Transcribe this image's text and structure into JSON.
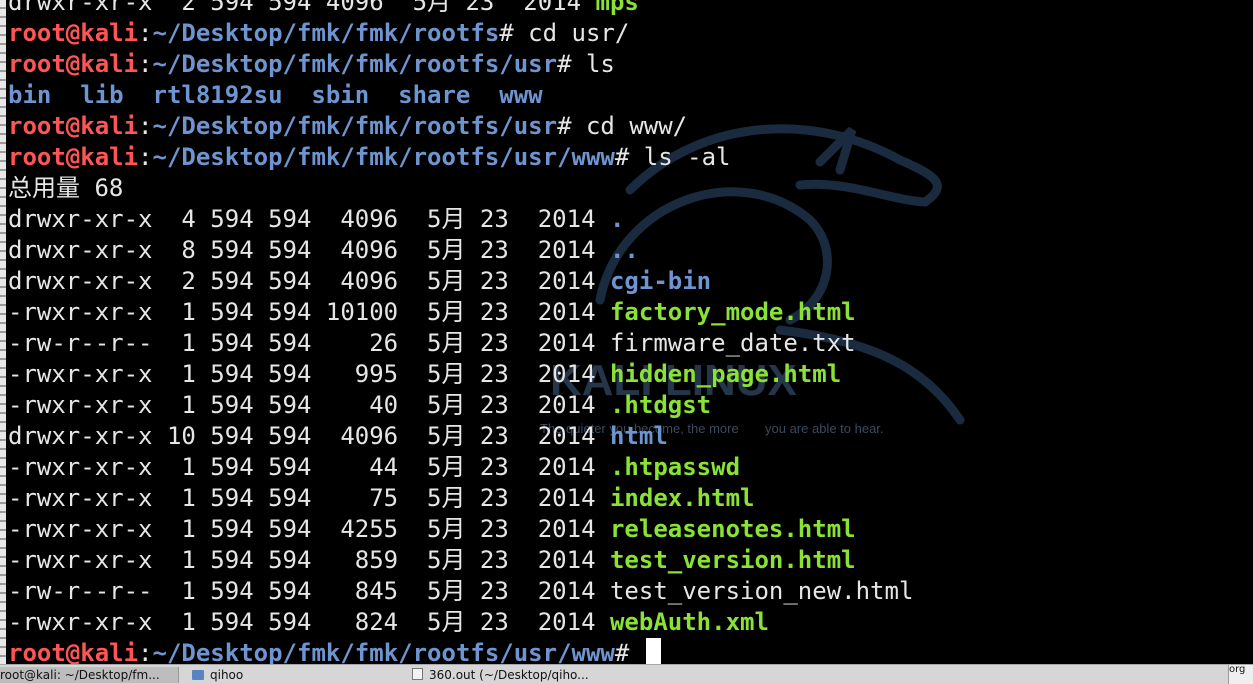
{
  "prompt": {
    "user": "root",
    "at": "@",
    "host": "kali",
    "sep": ":"
  },
  "watermark": {
    "title": "KALI LINUX",
    "quote_left": "The quieter you become, the more",
    "quote_right": "you are able to hear."
  },
  "lines": [
    [
      {
        "c": "plain",
        "t": "drwxr-xr-x  2 594 594 4096  5月 23  2014 "
      },
      {
        "c": "exe",
        "t": "mps"
      }
    ],
    [
      {
        "c": "red",
        "t": "root@kali"
      },
      {
        "c": "plain",
        "t": ":"
      },
      {
        "c": "path",
        "t": "~/Desktop/fmk/fmk/rootfs"
      },
      {
        "c": "plain",
        "t": "# cd usr/"
      }
    ],
    [
      {
        "c": "red",
        "t": "root@kali"
      },
      {
        "c": "plain",
        "t": ":"
      },
      {
        "c": "path",
        "t": "~/Desktop/fmk/fmk/rootfs/usr"
      },
      {
        "c": "plain",
        "t": "# ls"
      }
    ],
    [
      {
        "c": "dir",
        "t": "bin  lib  rtl8192su  sbin  share  www"
      }
    ],
    [
      {
        "c": "red",
        "t": "root@kali"
      },
      {
        "c": "plain",
        "t": ":"
      },
      {
        "c": "path",
        "t": "~/Desktop/fmk/fmk/rootfs/usr"
      },
      {
        "c": "plain",
        "t": "# cd www/"
      }
    ],
    [
      {
        "c": "red",
        "t": "root@kali"
      },
      {
        "c": "plain",
        "t": ":"
      },
      {
        "c": "path",
        "t": "~/Desktop/fmk/fmk/rootfs/usr/www"
      },
      {
        "c": "plain",
        "t": "# ls -al"
      }
    ],
    [
      {
        "c": "plain",
        "t": "总用量 68"
      }
    ],
    [
      {
        "c": "plain",
        "t": "drwxr-xr-x  4 594 594  4096  5月 23  2014 "
      },
      {
        "c": "dir",
        "t": "."
      }
    ],
    [
      {
        "c": "plain",
        "t": "drwxr-xr-x  8 594 594  4096  5月 23  2014 "
      },
      {
        "c": "dir",
        "t": ".."
      }
    ],
    [
      {
        "c": "plain",
        "t": "drwxr-xr-x  2 594 594  4096  5月 23  2014 "
      },
      {
        "c": "dir",
        "t": "cgi-bin"
      }
    ],
    [
      {
        "c": "plain",
        "t": "-rwxr-xr-x  1 594 594 10100  5月 23  2014 "
      },
      {
        "c": "exe",
        "t": "factory_mode.html"
      }
    ],
    [
      {
        "c": "plain",
        "t": "-rw-r--r--  1 594 594    26  5月 23  2014 "
      },
      {
        "c": "plain",
        "t": "firmware_date.txt"
      }
    ],
    [
      {
        "c": "plain",
        "t": "-rwxr-xr-x  1 594 594   995  5月 23  2014 "
      },
      {
        "c": "exe",
        "t": "hidden_page.html"
      }
    ],
    [
      {
        "c": "plain",
        "t": "-rwxr-xr-x  1 594 594    40  5月 23  2014 "
      },
      {
        "c": "exe",
        "t": ".htdgst"
      }
    ],
    [
      {
        "c": "plain",
        "t": "drwxr-xr-x 10 594 594  4096  5月 23  2014 "
      },
      {
        "c": "dir",
        "t": "html"
      }
    ],
    [
      {
        "c": "plain",
        "t": "-rwxr-xr-x  1 594 594    44  5月 23  2014 "
      },
      {
        "c": "exe",
        "t": ".htpasswd"
      }
    ],
    [
      {
        "c": "plain",
        "t": "-rwxr-xr-x  1 594 594    75  5月 23  2014 "
      },
      {
        "c": "exe",
        "t": "index.html"
      }
    ],
    [
      {
        "c": "plain",
        "t": "-rwxr-xr-x  1 594 594  4255  5月 23  2014 "
      },
      {
        "c": "exe",
        "t": "releasenotes.html"
      }
    ],
    [
      {
        "c": "plain",
        "t": "-rwxr-xr-x  1 594 594   859  5月 23  2014 "
      },
      {
        "c": "exe",
        "t": "test_version.html"
      }
    ],
    [
      {
        "c": "plain",
        "t": "-rw-r--r--  1 594 594   845  5月 23  2014 "
      },
      {
        "c": "plain",
        "t": "test_version_new.html"
      }
    ],
    [
      {
        "c": "plain",
        "t": "-rwxr-xr-x  1 594 594   824  5月 23  2014 "
      },
      {
        "c": "exe",
        "t": "webAuth.xml"
      }
    ],
    [
      {
        "c": "red",
        "t": "root@kali"
      },
      {
        "c": "plain",
        "t": ":"
      },
      {
        "c": "path",
        "t": "~/Desktop/fmk/fmk/rootfs/usr/www"
      },
      {
        "c": "plain",
        "t": "# "
      }
    ]
  ],
  "taskbar": {
    "items": [
      {
        "label": "root@kali: ~/Desktop/fm...",
        "icon": "terminal-icon"
      },
      {
        "label": "qihoo",
        "icon": "folder-icon"
      },
      {
        "label": "360.out (~/Desktop/qiho...",
        "icon": "text-editor-icon"
      }
    ],
    "tray_text": "org"
  },
  "colors": {
    "red": "#ff5555",
    "path": "#6f95d1",
    "exe": "#8ae234",
    "text": "#e6e6e6",
    "bg": "#000000"
  }
}
